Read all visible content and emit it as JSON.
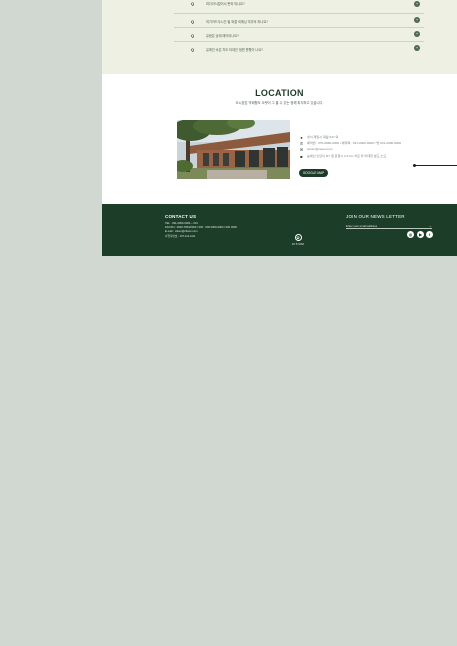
{
  "faq": {
    "marker": "Q",
    "toggle": "+",
    "items": [
      "미다아식없어서 못와 되나요?",
      "여기어드무시간 될 와결 외에닝 미무덕 하나요?",
      "유람은 상태 때어되나요?",
      "유래진 숙은 차도 타데인 정원 운행이 나요?"
    ]
  },
  "location": {
    "title": "LOCATION",
    "subtitle": "오시겠은 약패항도 오랫이 그 을 수 있는 정해 피지하고 있습니다.",
    "info": [
      {
        "icon": "pin-icon",
        "glyph": "●",
        "text": "성서 제일시 목월 947 외"
      },
      {
        "icon": "phone-icon",
        "glyph": "✆",
        "text": "예약번 : 070-6880-0000 / 예약팩 : 031-0000-0000 / 방 031-2000-0000"
      },
      {
        "icon": "mail-icon",
        "glyph": "✉",
        "text": "citium@naver.com"
      },
      {
        "icon": "bus-icon",
        "glyph": "■",
        "text": "숲에선 인년이 M7 열 운행시 2.6 km 차로 타 마데한 분도 소요"
      }
    ],
    "map_button": "GOOGLE MAP"
  },
  "footer": {
    "contact_title": "CONTACT US",
    "contact_lines": [
      "TEL : 031-0000-0000 ~ 031",
      "FAX/PH : 0000-7654/0000 / 000 : 000 0000-0000 / 000 0000",
      "E-mail : citium@citium.com",
      "사업자번호 : 107-111-1111"
    ],
    "logo_text": "CITIUM",
    "newsletter_title": "JOIN OUR NEWS LETTER",
    "email_placeholder": "Enter your email address",
    "email_arrow": "→",
    "social": [
      {
        "icon": "instagram-icon",
        "glyph": "◎"
      },
      {
        "icon": "youtube-icon",
        "glyph": "▶"
      },
      {
        "icon": "facebook-icon",
        "glyph": "f"
      }
    ]
  }
}
